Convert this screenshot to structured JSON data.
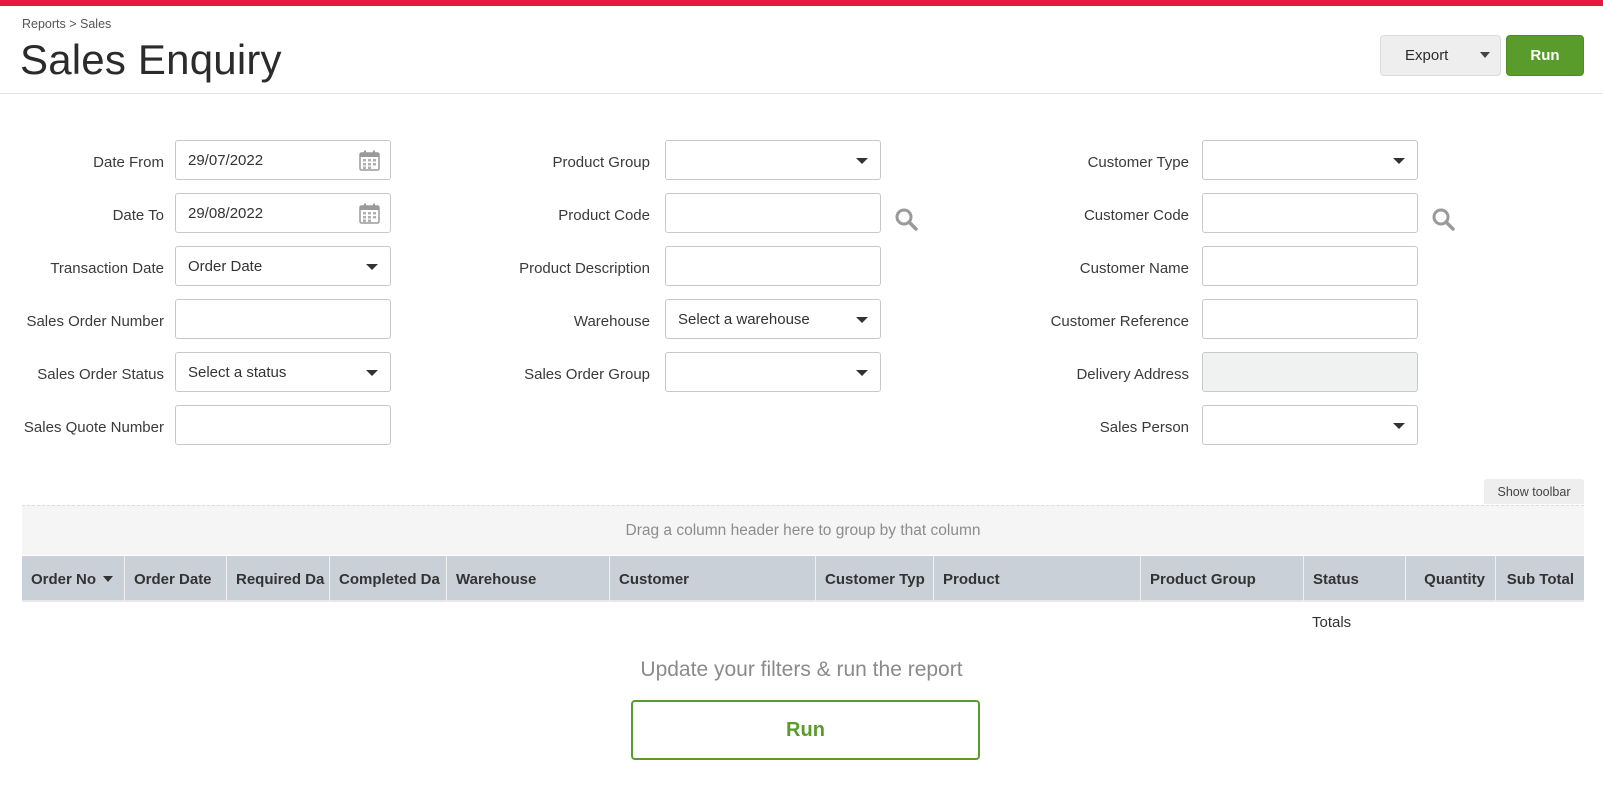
{
  "header": {
    "breadcrumb": "Reports > Sales",
    "title": "Sales Enquiry",
    "export_label": "Export",
    "run_label": "Run"
  },
  "filters": {
    "date_from": {
      "label": "Date From",
      "value": "29/07/2022"
    },
    "date_to": {
      "label": "Date To",
      "value": "29/08/2022"
    },
    "transaction_date": {
      "label": "Transaction Date",
      "value": "Order Date"
    },
    "sales_order_number": {
      "label": "Sales Order Number",
      "value": ""
    },
    "sales_order_status": {
      "label": "Sales Order Status",
      "value": "Select a status"
    },
    "sales_quote_number": {
      "label": "Sales Quote Number",
      "value": ""
    },
    "product_group": {
      "label": "Product Group",
      "value": ""
    },
    "product_code": {
      "label": "Product Code",
      "value": ""
    },
    "product_description": {
      "label": "Product Description",
      "value": ""
    },
    "warehouse": {
      "label": "Warehouse",
      "value": "Select a warehouse"
    },
    "sales_order_group": {
      "label": "Sales Order Group",
      "value": ""
    },
    "customer_type": {
      "label": "Customer Type",
      "value": ""
    },
    "customer_code": {
      "label": "Customer Code",
      "value": ""
    },
    "customer_name": {
      "label": "Customer Name",
      "value": ""
    },
    "customer_reference": {
      "label": "Customer Reference",
      "value": ""
    },
    "delivery_address": {
      "label": "Delivery Address",
      "value": ""
    },
    "sales_person": {
      "label": "Sales Person",
      "value": ""
    }
  },
  "grid": {
    "show_toolbar_label": "Show toolbar",
    "group_panel_text": "Drag a column header here to group by that column",
    "columns": [
      "Order No",
      "Order Date",
      "Required Da",
      "Completed Da",
      "Warehouse",
      "Customer",
      "Customer Typ",
      "Product",
      "Product Group",
      "Status",
      "Quantity",
      "Sub Total"
    ],
    "totals_label": "Totals"
  },
  "empty_state": {
    "message": "Update your filters & run the report",
    "run_label": "Run"
  },
  "colors": {
    "brand_red": "#e31c3d",
    "accent_green": "#5a9c2b",
    "grid_header_bg": "#c9d0d8"
  },
  "icons": {
    "calendar": "calendar-icon",
    "search": "search-icon",
    "dropdown": "chevron-down-icon"
  }
}
